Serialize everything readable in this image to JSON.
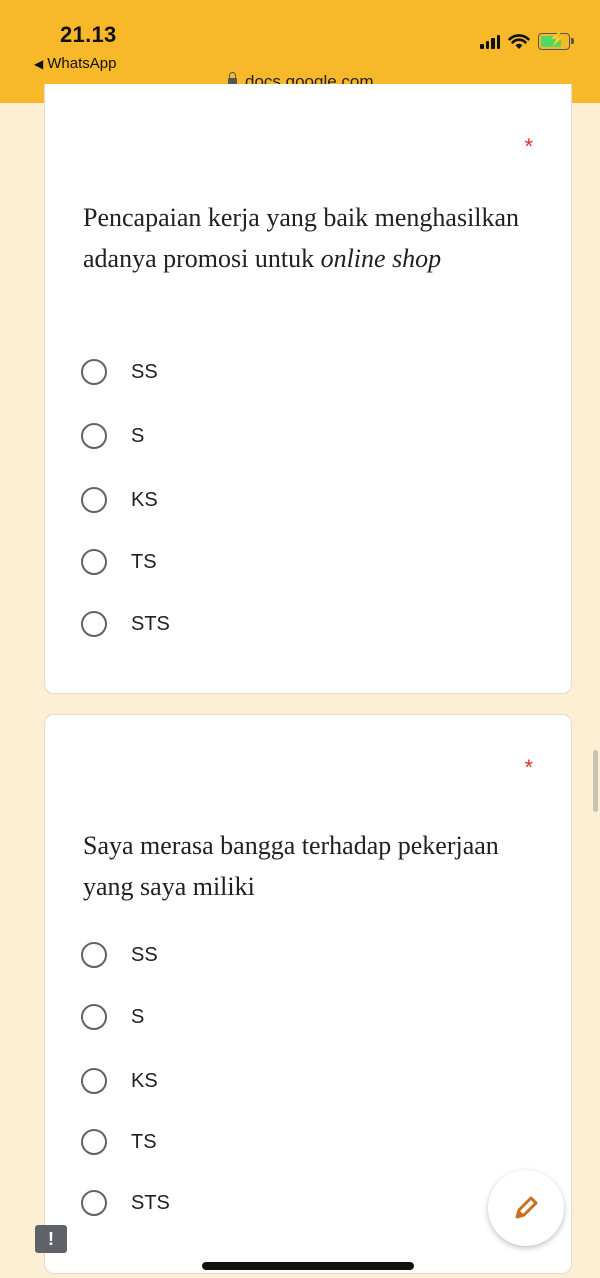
{
  "status_bar": {
    "time": "21.13",
    "back_label": "WhatsApp",
    "url": "docs.google.com",
    "icons": [
      "signal-icon",
      "wifi-icon",
      "battery-charging-icon"
    ]
  },
  "questions": [
    {
      "required_mark": "*",
      "text_main": "Pencapaian kerja yang baik menghasilkan adanya promosi untuk ",
      "text_italic": "online shop",
      "options": [
        "SS",
        "S",
        "KS",
        "TS",
        "STS"
      ]
    },
    {
      "required_mark": "*",
      "text_main": "Saya merasa bangga terhadap pekerjaan yang saya miliki",
      "options": [
        "SS",
        "S",
        "KS",
        "TS",
        "STS"
      ]
    }
  ],
  "fab": {
    "icon": "pencil-icon"
  },
  "feedback": {
    "icon": "feedback-icon",
    "glyph": "!"
  },
  "colors": {
    "status_bar": "#f7b829",
    "page_bg": "#fcefd3",
    "required": "#d93025",
    "pencil": "#c8701c"
  }
}
